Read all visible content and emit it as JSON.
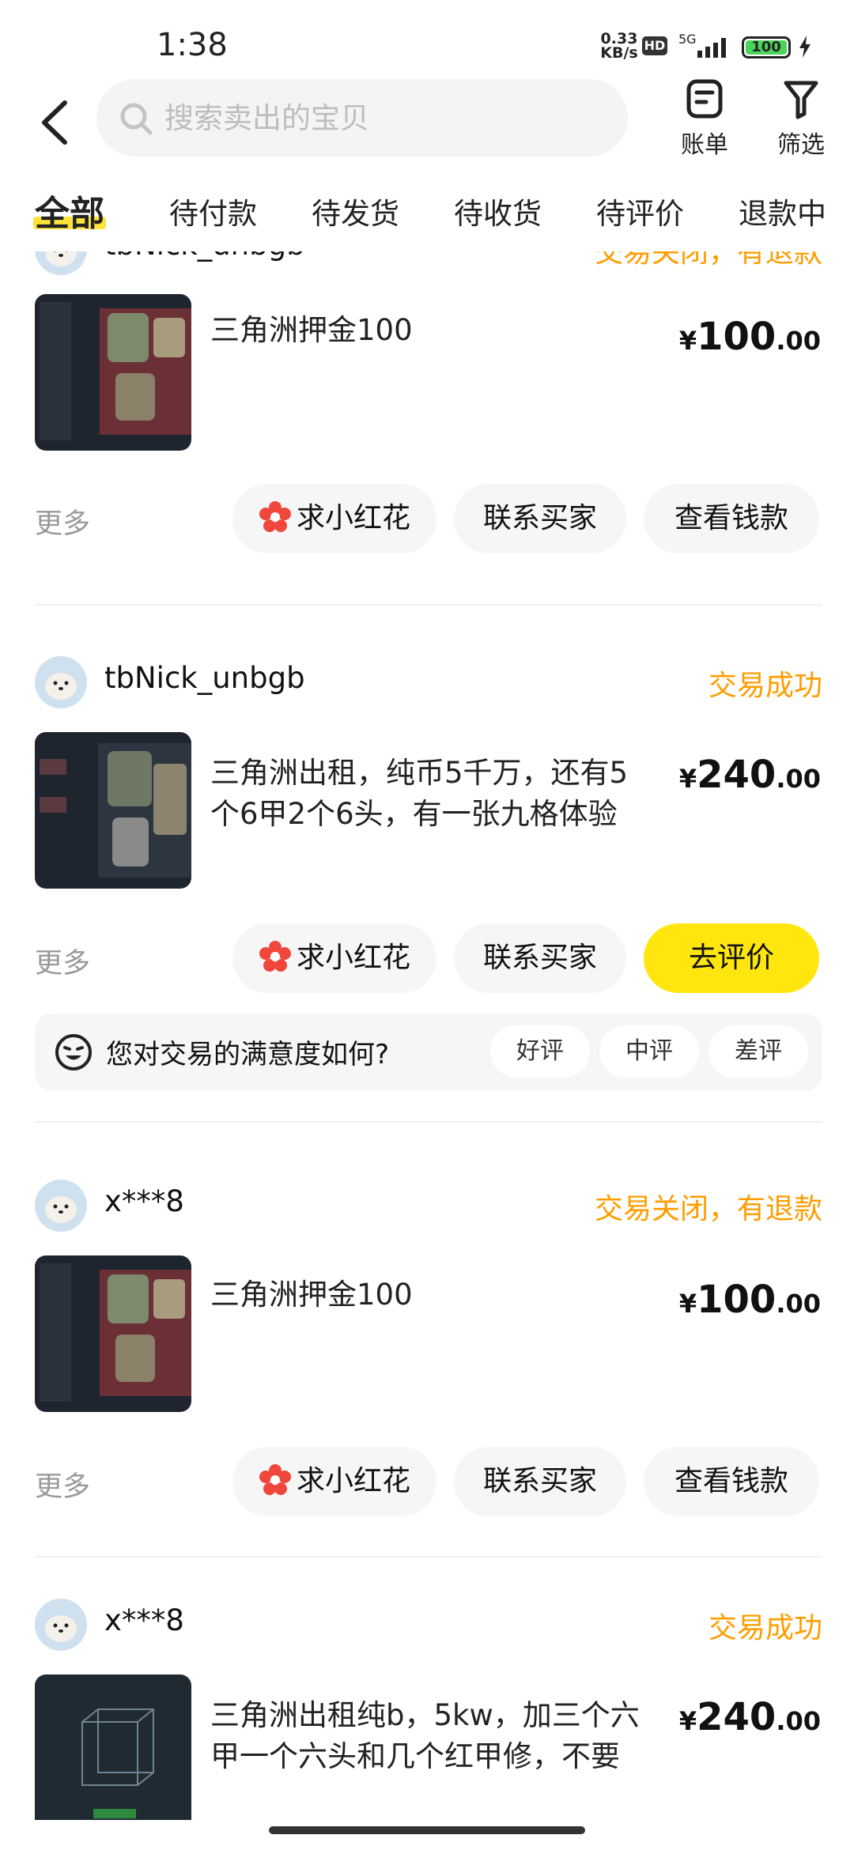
{
  "status_bar": {
    "time": "1:38",
    "net_speed_value": "0.33",
    "net_speed_unit": "KB/s",
    "hd": "HD",
    "network": "5G",
    "battery": "100"
  },
  "search": {
    "placeholder": "搜索卖出的宝贝"
  },
  "toolbar": {
    "bill_label": "账单",
    "filter_label": "筛选"
  },
  "tabs": [
    "全部",
    "待付款",
    "待发货",
    "待收货",
    "待评价",
    "退款中"
  ],
  "actions": {
    "more": "更多",
    "flower": "求小红花",
    "contact": "联系买家",
    "view_money": "查看钱款",
    "review": "去评价"
  },
  "rating": {
    "question": "您对交易的满意度如何?",
    "options": [
      "好评",
      "中评",
      "差评"
    ]
  },
  "orders": [
    {
      "user": "tbNick_unbgb",
      "status": "交易关闭，有退款",
      "title": "三角洲押金100",
      "price_yen": "¥",
      "price_int": "100",
      "price_dec": ".00"
    },
    {
      "user": "tbNick_unbgb",
      "status": "交易成功",
      "title": "三角洲出租，纯币5千万，还有5个6甲2个6头，有一张九格体验",
      "price_yen": "¥",
      "price_int": "240",
      "price_dec": ".00"
    },
    {
      "user": "x***8",
      "status": "交易关闭，有退款",
      "title": "三角洲押金100",
      "price_yen": "¥",
      "price_int": "100",
      "price_dec": ".00"
    },
    {
      "user": "x***8",
      "status": "交易成功",
      "title": "三角洲出租纯b，5kw，加三个六甲一个六头和几个红甲修，不要",
      "price_yen": "¥",
      "price_int": "240",
      "price_dec": ".00"
    }
  ],
  "colors": {
    "accent_yellow": "#ffe60f",
    "status_orange": "#ff9d00",
    "flower_red": "#f0473c"
  }
}
